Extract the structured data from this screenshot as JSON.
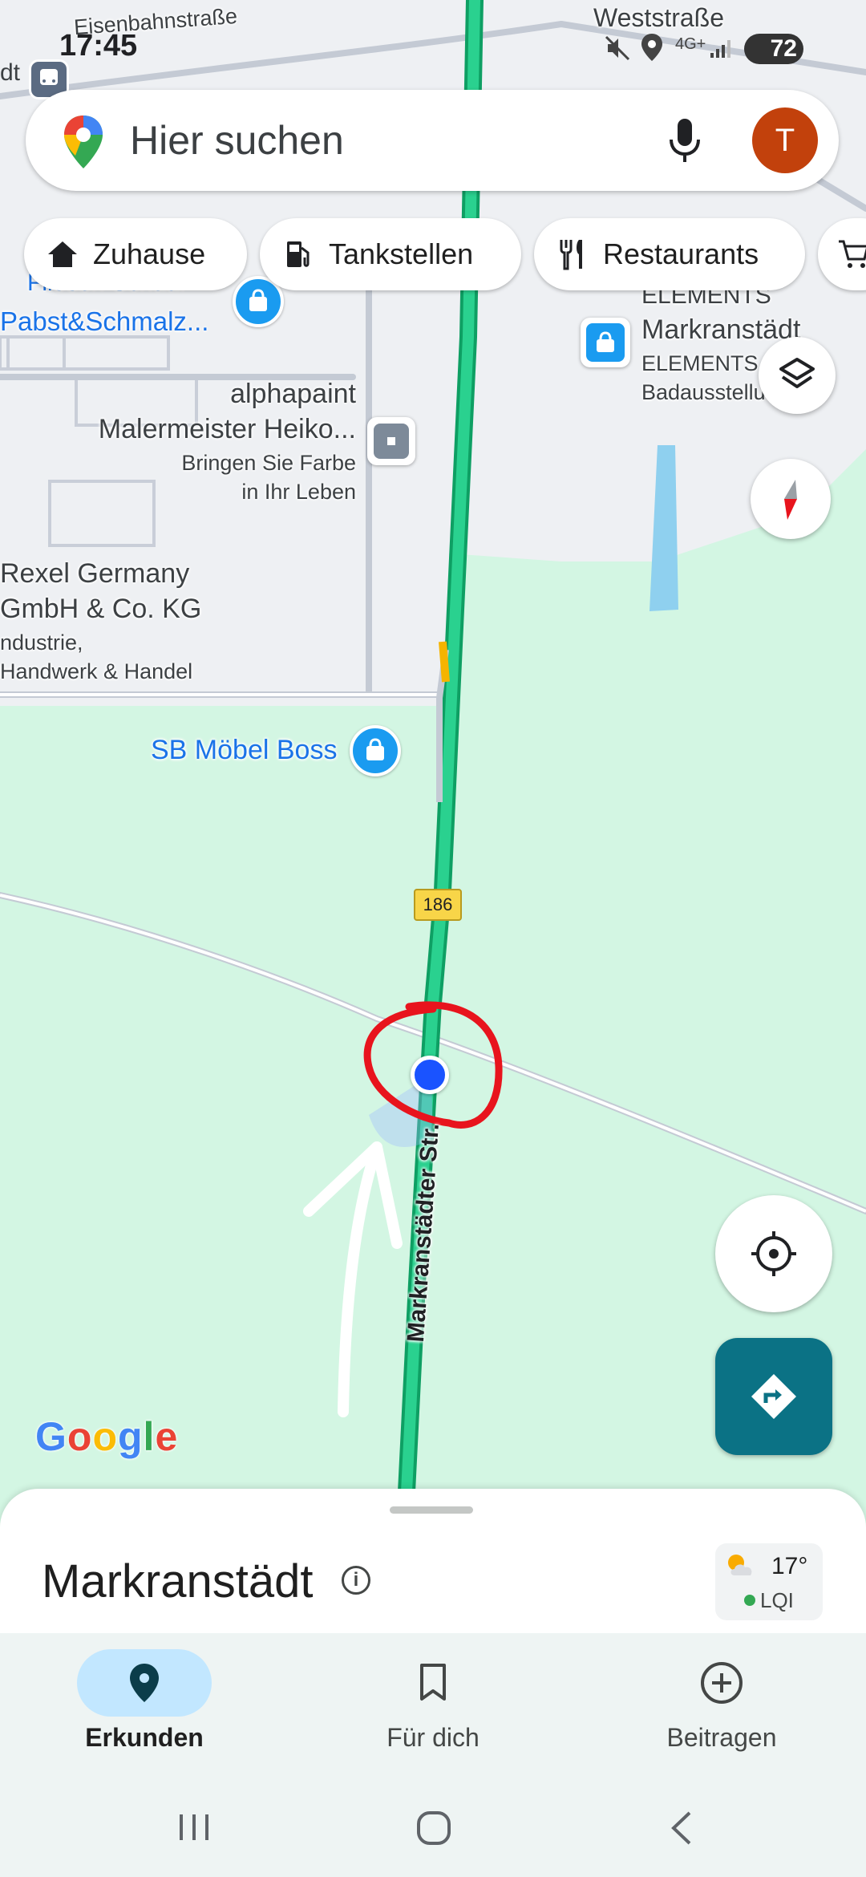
{
  "status_bar": {
    "time": "17:45",
    "network": "4G+",
    "battery": "72",
    "top_left_street": "Eisenbahnstraße",
    "top_right_street": "Weststraße",
    "top_left_fragment": "dt"
  },
  "search": {
    "placeholder": "Hier suchen",
    "avatar_letter": "T"
  },
  "chips": [
    {
      "label": "Zuhause",
      "icon": "home-icon"
    },
    {
      "label": "Tankstellen",
      "icon": "fuel-pump-icon"
    },
    {
      "label": "Restaurants",
      "icon": "restaurant-icon"
    },
    {
      "label": "",
      "icon": "shopping-cart-icon"
    }
  ],
  "map": {
    "places": {
      "fliesen_partial": "Fliesen Schaaf",
      "pabst": "Pabst&Schmalz...",
      "alphapaint_name1": "alphapaint",
      "alphapaint_name2": "Malermeister Heiko...",
      "alphapaint_desc1": "Bringen Sie Farbe",
      "alphapaint_desc2": "in Ihr Leben",
      "rexel_name1": "Rexel Germany",
      "rexel_name2": "GmbH & Co. KG",
      "rexel_desc1": "ndustrie,",
      "rexel_desc2": "Handwerk & Handel",
      "moebel_boss": "SB Möbel Boss",
      "elements_top": "ELEMENTS",
      "elements_name": "Markranstädt",
      "elements_sub1": "ELEMENTS",
      "elements_sub2": "Badausstellung..."
    },
    "road_shield": "186",
    "road_name": "Markranstädter Str.",
    "google_logo": "Google",
    "colors": {
      "land": "#d3f6e3",
      "industrial": "#eef0f3",
      "road": "#18c07c",
      "location": "#1a53ff",
      "annotation_circle": "#e8141d",
      "shop_pin": "#1a9bf0",
      "directions_fab": "#0b7285"
    }
  },
  "sheet": {
    "place_title": "Markranstädt",
    "temperature": "17°",
    "air_quality": "LQI"
  },
  "bottom_nav": {
    "items": [
      {
        "label": "Erkunden",
        "icon": "explore-pin-icon",
        "active": true
      },
      {
        "label": "Für dich",
        "icon": "bookmark-icon",
        "active": false
      },
      {
        "label": "Beitragen",
        "icon": "add-circle-icon",
        "active": false
      }
    ]
  }
}
